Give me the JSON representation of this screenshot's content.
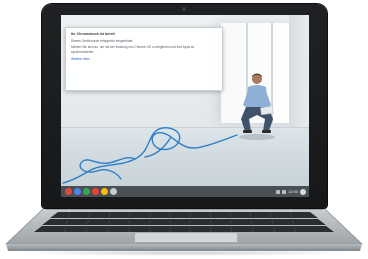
{
  "notification": {
    "title": "Ihr Chromebook ist bereit",
    "line1": "Dieses Gerät wurde erfolgreich eingerichtet.",
    "line2": "Melden Sie sich an, um mit der Nutzung von Chrome OS zu beginnen und Ihre Apps zu synchronisieren.",
    "link": "Weitere Infos"
  },
  "shelf": {
    "apps": [
      {
        "icon": "chrome-icon",
        "color": "#e8453c"
      },
      {
        "icon": "gmail-icon",
        "color": "#4a86e8"
      },
      {
        "icon": "search-icon",
        "color": "#34a853"
      },
      {
        "icon": "youtube-icon",
        "color": "#ea4335"
      },
      {
        "icon": "docs-icon",
        "color": "#fbbc05"
      },
      {
        "icon": "apps-launcher-icon",
        "color": "#c6cbd0"
      }
    ],
    "time": "12:00"
  }
}
